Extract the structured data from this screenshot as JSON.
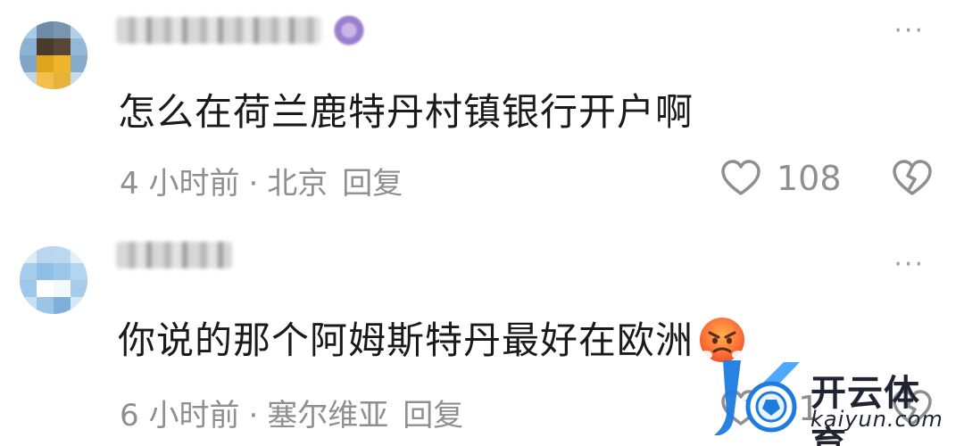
{
  "comments": [
    {
      "text": "怎么在荷兰鹿特丹村镇银行开户啊",
      "time": "4 小时前",
      "separator": "·",
      "location": "北京",
      "reply_label": "回复",
      "like_count": "108",
      "more_label": "···"
    },
    {
      "text": "你说的那个阿姆斯特丹最好在欧洲",
      "time": "6 小时前",
      "separator": "·",
      "location": "塞尔维亚",
      "reply_label": "回复",
      "like_count": "61",
      "more_label": "···"
    }
  ],
  "watermark": {
    "brand": "开云体育",
    "domain": "kaiyun.com"
  },
  "colors": {
    "meta_text": "#8e8e93",
    "body_text": "#1a1a1a",
    "watermark_blue": "#1e7be0"
  },
  "icons": {
    "like": "heart-outline-icon",
    "dislike": "broken-heart-icon",
    "more": "more-dots-icon",
    "emoji": "angry-face-emoji"
  }
}
